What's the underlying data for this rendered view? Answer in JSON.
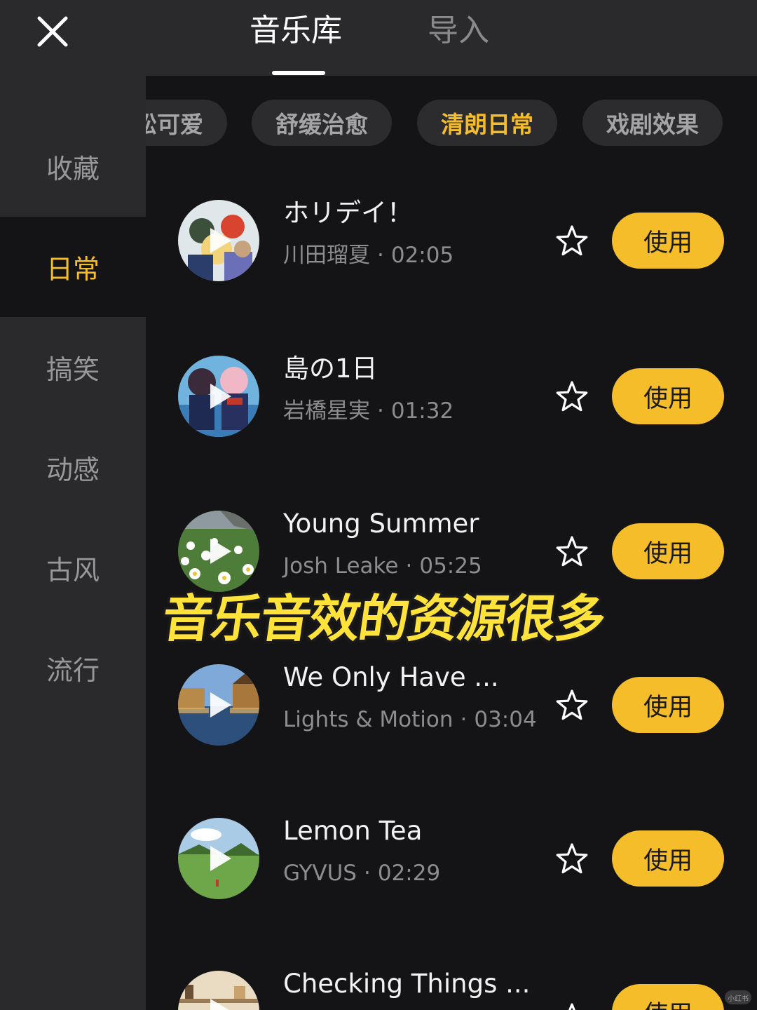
{
  "header": {
    "tabs": [
      {
        "label": "音乐库",
        "active": true
      },
      {
        "label": "导入",
        "active": false
      }
    ],
    "close_icon": "close-icon"
  },
  "sidebar": {
    "items": [
      {
        "label": "收藏",
        "active": false
      },
      {
        "label": "日常",
        "active": true
      },
      {
        "label": "搞笑",
        "active": false
      },
      {
        "label": "动感",
        "active": false
      },
      {
        "label": "古风",
        "active": false
      },
      {
        "label": "流行",
        "active": false
      }
    ]
  },
  "chips": [
    {
      "label": "松可爱",
      "active": false
    },
    {
      "label": "舒缓治愈",
      "active": false
    },
    {
      "label": "清朗日常",
      "active": true
    },
    {
      "label": "戏剧效果",
      "active": false
    }
  ],
  "tracks": [
    {
      "title": "ホリデイ！",
      "artist": "川田瑠夏",
      "separator": "·",
      "duration": "02:05",
      "use_label": "使用",
      "cover": "anime-girls-cover"
    },
    {
      "title": "島の1日",
      "artist": "岩橋星実",
      "separator": "·",
      "duration": "01:32",
      "use_label": "使用",
      "cover": "anime-schoolgirls-cover"
    },
    {
      "title": "Young Summer",
      "artist": "Josh Leake",
      "separator": "·",
      "duration": "05:25",
      "use_label": "使用",
      "cover": "daisy-field-cover"
    },
    {
      "title": "We Only Have ...",
      "artist": "Lights & Motion",
      "separator": "·",
      "duration": "03:04",
      "use_label": "使用",
      "cover": "canal-town-cover"
    },
    {
      "title": "Lemon Tea",
      "artist": "GYVUS",
      "separator": "·",
      "duration": "02:29",
      "use_label": "使用",
      "cover": "green-meadow-cover"
    },
    {
      "title": "Checking Things ...",
      "artist": "",
      "separator": "",
      "duration": "",
      "use_label": "使用",
      "cover": "kitchen-shelf-cover"
    }
  ],
  "overlay_caption": "音乐音效的资源很多",
  "watermark": "小红书",
  "colors": {
    "accent": "#f6bd2b",
    "background": "#141416",
    "panel": "#2a2a2c",
    "caption": "#ffe23a"
  }
}
